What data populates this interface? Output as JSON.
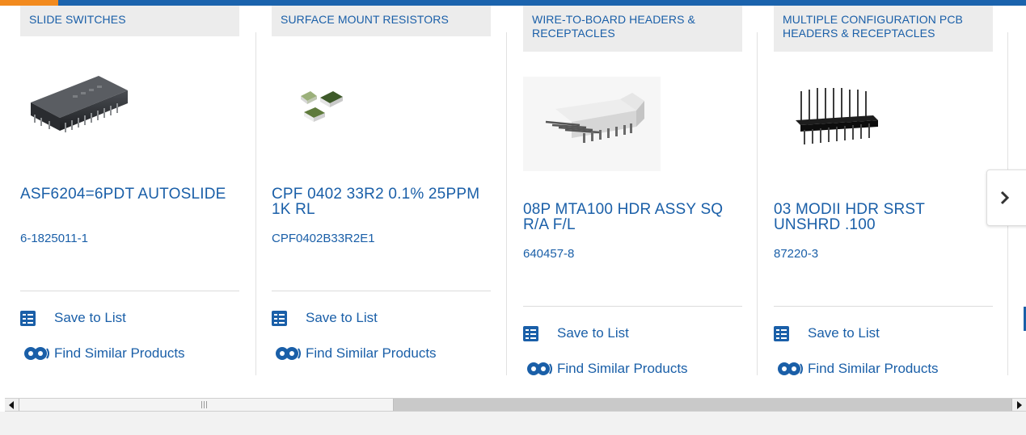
{
  "cards": [
    {
      "category": "SLIDE SWITCHES",
      "name": "ASF6204=6PDT AUTOSLIDE",
      "part_number": "6-1825011-1",
      "save_label": "Save to List",
      "similar_label": "Find Similar Products"
    },
    {
      "category": "SURFACE MOUNT RESISTORS",
      "name": "CPF 0402 33R2 0.1% 25PPM 1K RL",
      "part_number": "CPF0402B33R2E1",
      "save_label": "Save to List",
      "similar_label": "Find Similar Products"
    },
    {
      "category": "WIRE-TO-BOARD HEADERS & RECEPTACLES",
      "name": "08P MTA100 HDR ASSY SQ R/A F/L",
      "part_number": "640457-8",
      "save_label": "Save to List",
      "similar_label": "Find Similar Products"
    },
    {
      "category": "MULTIPLE CONFIGURATION PCB HEADERS & RECEPTACLES",
      "name": "03 MODII HDR SRST UNSHRD .100",
      "part_number": "87220-3",
      "save_label": "Save to List",
      "similar_label": "Find Similar Products"
    }
  ],
  "icons": {
    "next": "chevron-right-icon",
    "save": "checklist-icon",
    "similar": "gears-icon"
  },
  "colors": {
    "link": "#1a5fa8",
    "top_bar": "#1b63ad",
    "top_accent": "#f28a1e",
    "category_bg": "#ececec"
  }
}
